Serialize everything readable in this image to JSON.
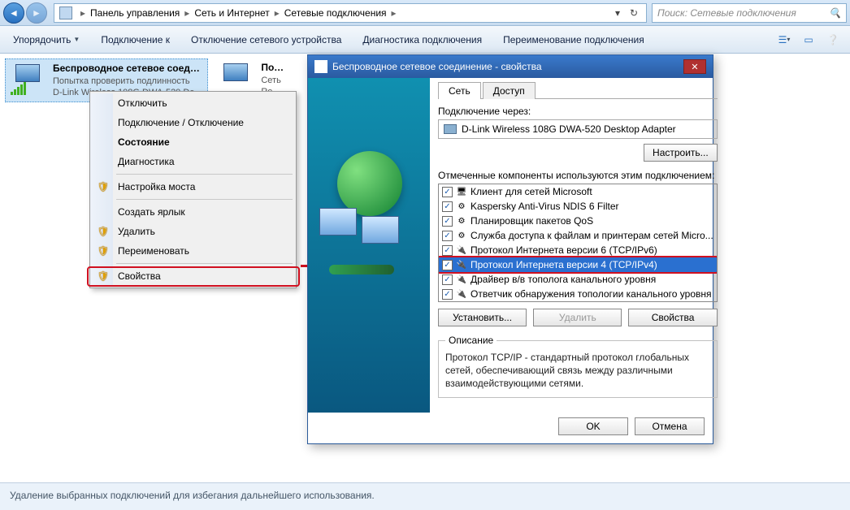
{
  "breadcrumbs": [
    "Панель управления",
    "Сеть и Интернет",
    "Сетевые подключения"
  ],
  "search": {
    "placeholder": "Поиск: Сетевые подключения"
  },
  "toolbar": {
    "organize": "Упорядочить",
    "connect_to": "Подключение к",
    "disconnect_device": "Отключение сетевого устройства",
    "diagnostics": "Диагностика подключения",
    "rename": "Переименование подключения"
  },
  "connections": [
    {
      "name": "Беспроводное сетевое соединение",
      "status": "Попытка проверить подлинность",
      "device": "D-Link Wireless 108G DWA-520 De..."
    },
    {
      "name": "Подкл...",
      "status": "Сеть",
      "device": "Realtek..."
    }
  ],
  "context_menu": {
    "items": [
      {
        "label": "Отключить",
        "icon": ""
      },
      {
        "label": "Подключение / Отключение",
        "icon": ""
      },
      {
        "label": "Состояние",
        "bold": true,
        "icon": ""
      },
      {
        "label": "Диагностика",
        "icon": ""
      },
      {
        "sep": true
      },
      {
        "label": "Настройка моста",
        "icon": "shield"
      },
      {
        "sep": true
      },
      {
        "label": "Создать ярлык",
        "icon": ""
      },
      {
        "label": "Удалить",
        "icon": "shield"
      },
      {
        "label": "Переименовать",
        "icon": "shield"
      },
      {
        "sep": true
      },
      {
        "label": "Свойства",
        "icon": "shield",
        "highlight": true
      }
    ]
  },
  "dialog": {
    "title": "Беспроводное сетевое соединение - свойства",
    "tabs": [
      "Сеть",
      "Доступ"
    ],
    "connect_via_label": "Подключение через:",
    "adapter": "D-Link Wireless 108G DWA-520 Desktop Adapter",
    "configure": "Настроить...",
    "components_label": "Отмеченные компоненты используются этим подключением:",
    "components": [
      {
        "label": "Клиент для сетей Microsoft",
        "checked": true,
        "type": "client"
      },
      {
        "label": "Kaspersky Anti-Virus NDIS 6 Filter",
        "checked": true,
        "type": "service"
      },
      {
        "label": "Планировщик пакетов QoS",
        "checked": true,
        "type": "service"
      },
      {
        "label": "Служба доступа к файлам и принтерам сетей Micro...",
        "checked": true,
        "type": "service"
      },
      {
        "label": "Протокол Интернета версии 6 (TCP/IPv6)",
        "checked": true,
        "type": "proto"
      },
      {
        "label": "Протокол Интернета версии 4 (TCP/IPv4)",
        "checked": true,
        "type": "proto",
        "selected": true,
        "highlight": true
      },
      {
        "label": "Драйвер в/в тополога канального уровня",
        "checked": true,
        "type": "proto"
      },
      {
        "label": "Ответчик обнаружения топологии канального уровня",
        "checked": true,
        "type": "proto"
      }
    ],
    "install": "Установить...",
    "uninstall": "Удалить",
    "properties": "Свойства",
    "description_label": "Описание",
    "description": "Протокол TCP/IP - стандартный протокол глобальных сетей, обеспечивающий связь между различными взаимодействующими сетями.",
    "ok": "OK",
    "cancel": "Отмена"
  },
  "statusbar": "Удаление выбранных подключений для избегания дальнейшего использования."
}
